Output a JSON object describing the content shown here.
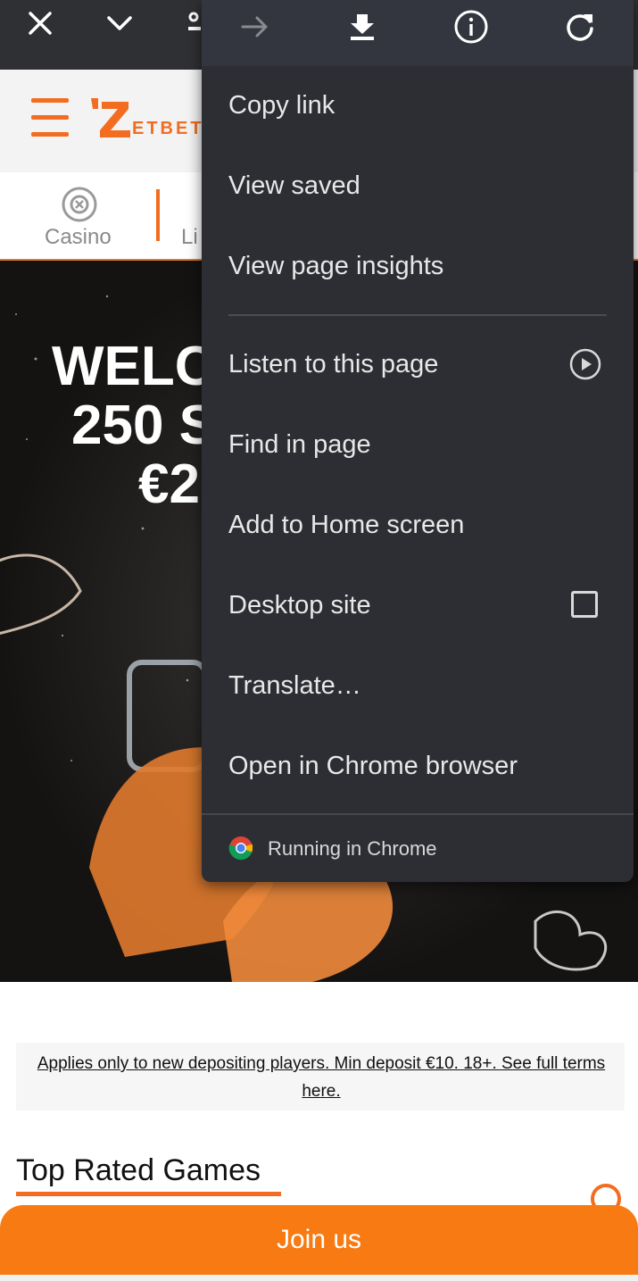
{
  "site": {
    "logo_text": "ETBET",
    "categories": [
      {
        "label": "Casino",
        "icon": "roulette-icon"
      },
      {
        "label": "Li",
        "icon": "live-icon"
      }
    ],
    "hero_lines": [
      "WELC",
      "250 S",
      "€2"
    ],
    "terms": "Applies only to new depositing players. Min deposit €10. 18+. See full terms here.",
    "section_title": "Top Rated Games",
    "join_button": "Join us"
  },
  "topbar": {
    "icons": [
      "close-icon",
      "chevron-down-icon",
      "lock-icon"
    ]
  },
  "menu": {
    "icon_row": [
      "forward-arrow-icon",
      "download-icon",
      "info-icon",
      "refresh-icon"
    ],
    "items": [
      {
        "label": "Copy link"
      },
      {
        "label": "View saved"
      },
      {
        "label": "View page insights"
      },
      {
        "label": "Listen to this page",
        "trailing": "play-circle-icon"
      },
      {
        "label": "Find in page"
      },
      {
        "label": "Add to Home screen"
      },
      {
        "label": "Desktop site",
        "trailing": "checkbox",
        "checked": false
      },
      {
        "label": "Translate…"
      },
      {
        "label": "Open in Chrome browser"
      }
    ],
    "footer": "Running in Chrome"
  },
  "colors": {
    "accent": "#f26d21",
    "join_button": "#f77a12",
    "menu_bg": "#2c2e33",
    "topbar_bg": "#2f3033"
  }
}
